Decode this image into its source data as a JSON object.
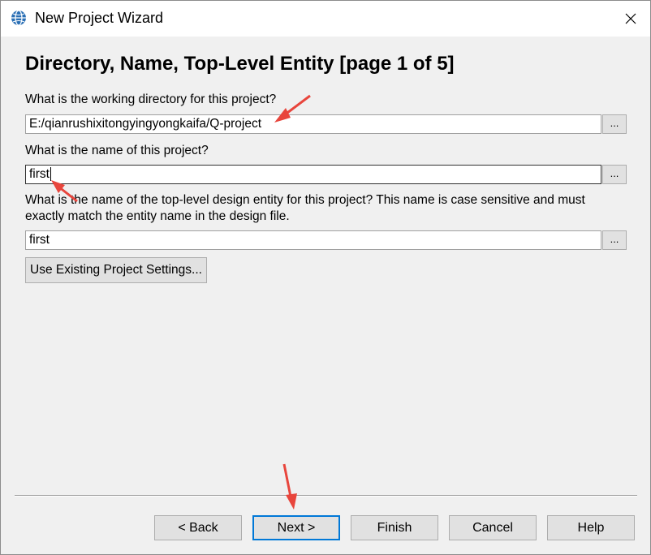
{
  "window": {
    "title": "New Project Wizard"
  },
  "page": {
    "title": "Directory, Name, Top-Level Entity [page 1 of 5]"
  },
  "fields": {
    "directory_label": "What is the working directory for this project?",
    "directory_value": "E:/qianrushixitongyingyongkaifa/Q-project",
    "name_label": "What is the name of this project?",
    "name_value": "first",
    "entity_label_line1": "What is the name of the top-level design entity for this project? This name is case sensitive and must",
    "entity_label_line2": "exactly match the entity name in the design file.",
    "entity_value": "first",
    "browse_label": "..."
  },
  "actions": {
    "use_existing": "Use Existing Project Settings..."
  },
  "footer": {
    "back": "< Back",
    "next": "Next >",
    "finish": "Finish",
    "cancel": "Cancel",
    "help": "Help"
  },
  "colors": {
    "window_bg": "#f0f0f0",
    "focus_accent": "#0078d7",
    "annotation_arrow": "#e8453c"
  },
  "icons": {
    "app": "quartus-globe-icon",
    "close": "close-icon"
  }
}
